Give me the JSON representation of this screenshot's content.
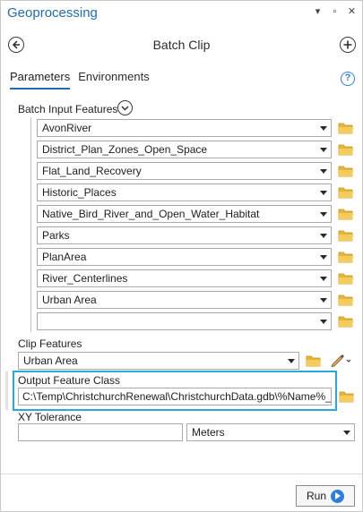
{
  "pane": {
    "title": "Geoprocessing",
    "controls": [
      "▾",
      "▫",
      "✕"
    ]
  },
  "header": {
    "title": "Batch Clip",
    "back_icon": "back-arrow-icon",
    "add_icon": "add-circle-icon"
  },
  "tabs": [
    {
      "label": "Parameters",
      "active": true
    },
    {
      "label": "Environments",
      "active": false
    }
  ],
  "help_label": "?",
  "batch_input": {
    "label": "Batch Input Features",
    "items": [
      "AvonRiver",
      "District_Plan_Zones_Open_Space",
      "Flat_Land_Recovery",
      "Historic_Places",
      "Native_Bird_River_and_Open_Water_Habitat",
      "Parks",
      "PlanArea",
      "River_Centerlines",
      "Urban Area",
      ""
    ]
  },
  "clip_features": {
    "label": "Clip Features",
    "value": "Urban Area"
  },
  "output_feature_class": {
    "label": "Output Feature Class",
    "value": "C:\\Temp\\ChristchurchRenewal\\ChristchurchData.gdb\\%Name%_Clip"
  },
  "xy_tolerance": {
    "label": "XY Tolerance",
    "value": "",
    "unit": "Meters"
  },
  "run_button": {
    "label": "Run"
  },
  "colors": {
    "accent": "#1f6bb8",
    "highlight": "#29a8e0",
    "folder": "#e8b53a"
  }
}
